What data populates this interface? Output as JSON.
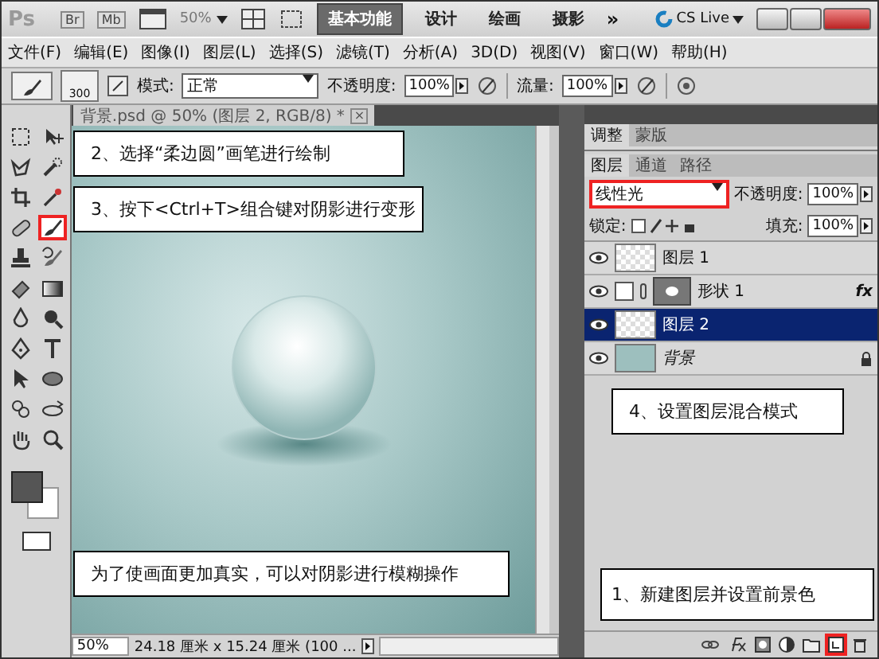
{
  "title_bar": {
    "logo": "Ps",
    "apps": [
      "Br",
      "Mb"
    ],
    "zoom": "50%",
    "workspaces": [
      {
        "label": "基本功能",
        "selected": true
      },
      {
        "label": "设计",
        "selected": false
      },
      {
        "label": "绘画",
        "selected": false
      },
      {
        "label": "摄影",
        "selected": false
      }
    ],
    "more": "»",
    "cs_live": "CS Live"
  },
  "menu_bar": [
    "文件(F)",
    "编辑(E)",
    "图像(I)",
    "图层(L)",
    "选择(S)",
    "滤镜(T)",
    "分析(A)",
    "3D(D)",
    "视图(V)",
    "窗口(W)",
    "帮助(H)"
  ],
  "options_bar": {
    "brush_size": "300",
    "mode_label": "模式:",
    "mode": "正常",
    "opacity_label": "不透明度:",
    "opacity": "100%",
    "flow_label": "流量:",
    "flow": "100%"
  },
  "document": {
    "tab": "背景.psd @ 50% (图层 2, RGB/8) *",
    "close": "×",
    "zoom": "50%",
    "info": "24.18 厘米 x 15.24 厘米 (100 ..."
  },
  "toolbox": {
    "tools": [
      {
        "kind": "marquee",
        "selected": false
      },
      {
        "kind": "move",
        "selected": false
      },
      {
        "kind": "lasso",
        "selected": false
      },
      {
        "kind": "wand",
        "selected": false
      },
      {
        "kind": "crop",
        "selected": false
      },
      {
        "kind": "eyedropper",
        "selected": false
      },
      {
        "kind": "healing",
        "selected": false
      },
      {
        "kind": "brush",
        "selected": true
      },
      {
        "kind": "stamp",
        "selected": false
      },
      {
        "kind": "history",
        "selected": false
      },
      {
        "kind": "eraser",
        "selected": false
      },
      {
        "kind": "gradient",
        "selected": false
      },
      {
        "kind": "blur",
        "selected": false
      },
      {
        "kind": "dodge",
        "selected": false
      },
      {
        "kind": "pen",
        "selected": false
      },
      {
        "kind": "type",
        "selected": false
      },
      {
        "kind": "select",
        "selected": false
      },
      {
        "kind": "shape",
        "selected": false
      },
      {
        "kind": "rotate3d",
        "selected": false
      },
      {
        "kind": "orbit3d",
        "selected": false
      },
      {
        "kind": "hand",
        "selected": false
      },
      {
        "kind": "zoom",
        "selected": false
      }
    ]
  },
  "adjust_tabs": [
    {
      "label": "调整",
      "selected": true
    },
    {
      "label": "蒙版",
      "selected": false
    }
  ],
  "layers_panel": {
    "tabs": [
      {
        "label": "图层",
        "selected": true
      },
      {
        "label": "通道",
        "selected": false
      },
      {
        "label": "路径",
        "selected": false
      }
    ],
    "blend_mode": "线性光",
    "opacity_label": "不透明度:",
    "opacity": "100%",
    "lock_label": "锁定:",
    "fill_label": "填充:",
    "fill": "100%",
    "layers": [
      {
        "name": "图层 1",
        "kind": "pixel",
        "selected": false
      },
      {
        "name": "形状 1",
        "kind": "shape",
        "selected": false,
        "fx": "fx"
      },
      {
        "name": "图层 2",
        "kind": "pixel",
        "selected": true
      },
      {
        "name": "背景",
        "kind": "background",
        "selected": false
      }
    ]
  },
  "callouts": [
    {
      "text": "2、选择“柔边圆”画笔进行绘制",
      "kind": "doc-top"
    },
    {
      "text": "3、按下<Ctrl+T>组合键对阴影进行变形",
      "kind": "doc-second"
    },
    {
      "text": "4、设置图层混合模式",
      "kind": "panel-middle"
    },
    {
      "text": "为了使画面更加真实，可以对阴影进行模糊操作",
      "kind": "doc-bottom"
    },
    {
      "text": "1、新建图层并设置前景色",
      "kind": "panel-bottom"
    }
  ]
}
